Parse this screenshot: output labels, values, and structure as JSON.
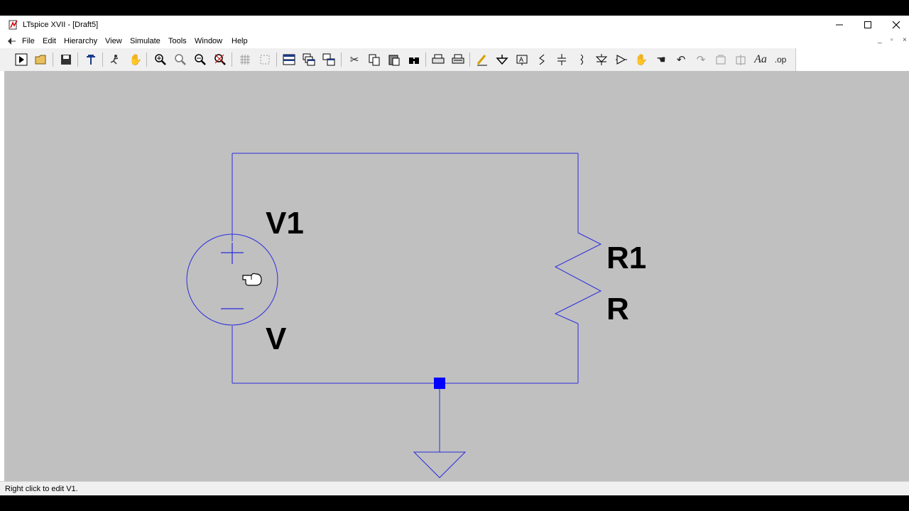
{
  "window": {
    "title": "LTspice XVII - [Draft5]"
  },
  "menu": {
    "items": [
      "File",
      "Edit",
      "Hierarchy",
      "View",
      "Simulate",
      "Tools",
      "Window",
      "Help"
    ]
  },
  "toolbar": {
    "icons": [
      "run-icon",
      "open-icon",
      "save-icon",
      "control-panel-icon",
      "halt-icon",
      "pan-hand-icon",
      "zoom-in-icon",
      "zoom-area-icon",
      "zoom-out-icon",
      "zoom-fit-icon",
      "tile-icon",
      "cascade-icon",
      "window-tile-icon",
      "window-stack-icon",
      "window-arrange-icon",
      "cut-icon",
      "copy-icon",
      "paste-icon",
      "find-icon",
      "print-icon",
      "print-preview-icon",
      "wire-icon",
      "ground-icon",
      "label-net-icon",
      "resistor-icon",
      "capacitor-icon",
      "inductor-icon",
      "diode-icon",
      "component-icon",
      "move-icon",
      "drag-icon",
      "undo-icon",
      "redo-icon",
      "rotate-icon",
      "mirror-icon",
      "text-icon",
      "spice-directive-icon"
    ]
  },
  "schematic": {
    "source": {
      "name": "V1",
      "value": "V"
    },
    "resistor": {
      "name": "R1",
      "value": "R"
    },
    "wire_color": "#2b2be0",
    "junction_color": "#0000ff"
  },
  "status": {
    "text": "Right click to edit V1."
  }
}
